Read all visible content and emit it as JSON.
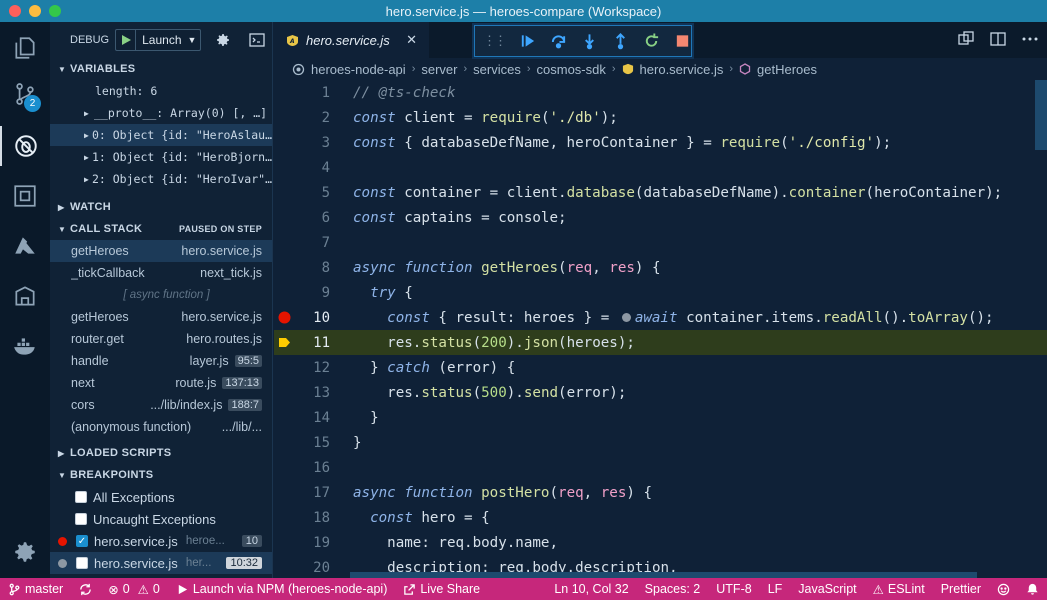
{
  "window": {
    "title": "hero.service.js — heroes-compare (Workspace)"
  },
  "activity_bar": {
    "scm_badge": "2"
  },
  "debug": {
    "label": "DEBUG",
    "config": "Launch"
  },
  "variables": {
    "header": "VARIABLES",
    "rows": [
      {
        "text": "length: 6",
        "indent": 1
      },
      {
        "text": "__proto__: Array(0) [, …]",
        "indent": 0
      },
      {
        "text": "0: Object {id: \"HeroAslau…",
        "indent": 0
      },
      {
        "text": "1: Object {id: \"HeroBjorn…",
        "indent": 0
      },
      {
        "text": "2: Object {id: \"HeroIvar\"…",
        "indent": 0
      }
    ]
  },
  "watch": {
    "header": "WATCH"
  },
  "call_stack": {
    "header": "CALL STACK",
    "status": "PAUSED ON STEP",
    "frames": [
      {
        "fn": "getHeroes",
        "file": "hero.service.js",
        "pos": ""
      },
      {
        "fn": "_tickCallback",
        "file": "next_tick.js",
        "pos": ""
      },
      {
        "fn": "[ async function ]",
        "file": "",
        "pos": ""
      },
      {
        "fn": "getHeroes",
        "file": "hero.service.js",
        "pos": ""
      },
      {
        "fn": "router.get",
        "file": "hero.routes.js",
        "pos": ""
      },
      {
        "fn": "handle",
        "file": "layer.js",
        "pos": "95:5"
      },
      {
        "fn": "next",
        "file": "route.js",
        "pos": "137:13"
      },
      {
        "fn": "cors",
        "file": ".../lib/index.js",
        "pos": "188:7"
      },
      {
        "fn": "(anonymous function)",
        "file": ".../lib/...",
        "pos": ""
      }
    ]
  },
  "loaded_scripts": {
    "header": "LOADED SCRIPTS"
  },
  "breakpoints": {
    "header": "BREAKPOINTS",
    "items": [
      {
        "label": "All Exceptions",
        "checked": false,
        "file": "",
        "pos": ""
      },
      {
        "label": "Uncaught Exceptions",
        "checked": false,
        "file": "",
        "pos": ""
      },
      {
        "label": "hero.service.js",
        "checked": true,
        "file": "heroe...",
        "pos": "10"
      },
      {
        "label": "hero.service.js",
        "checked": false,
        "file": "her...",
        "pos": "10:32"
      }
    ]
  },
  "editor": {
    "tab": "hero.service.js",
    "breadcrumb": [
      "heroes-node-api",
      "server",
      "services",
      "cosmos-sdk",
      "hero.service.js",
      "getHeroes"
    ],
    "lines": [
      "1",
      "2",
      "3",
      "4",
      "5",
      "6",
      "7",
      "8",
      "9",
      "10",
      "11",
      "12",
      "13",
      "14",
      "15",
      "16",
      "17",
      "18",
      "19",
      "20"
    ]
  },
  "status": {
    "branch": "master",
    "errors": "0",
    "warnings": "0",
    "launch": "Launch via NPM (heroes-node-api)",
    "live_share": "Live Share",
    "cursor": "Ln 10, Col 32",
    "spaces": "Spaces: 2",
    "encoding": "UTF-8",
    "eol": "LF",
    "language": "JavaScript",
    "eslint": "ESLint",
    "prettier": "Prettier"
  },
  "colors": {
    "title_bar": "#1d7fa8",
    "status_bar": "#c6277b",
    "breakpoint": "#e51400",
    "current_line": "#2e3d1c",
    "accent": "#1a8fcf"
  },
  "icons": [
    "explorer-icon",
    "source-control-icon",
    "debug-icon",
    "extensions-icon",
    "azure-icon",
    "remote-icon",
    "docker-icon",
    "gear-icon"
  ]
}
